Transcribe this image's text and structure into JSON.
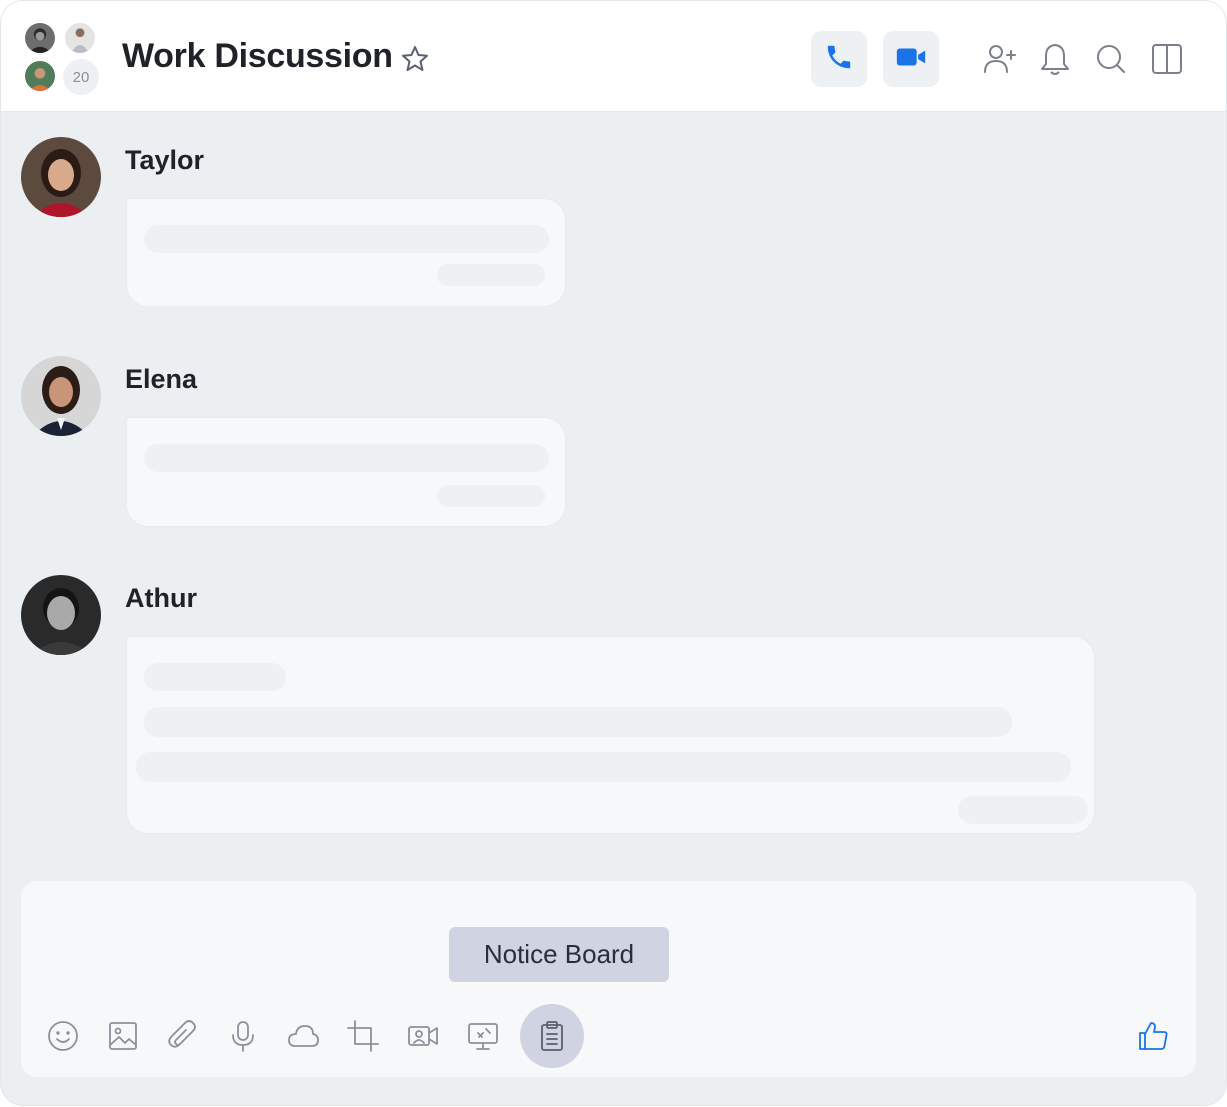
{
  "header": {
    "title": "Work Discussion",
    "member_count": "20",
    "icons": [
      "star-icon",
      "phone-icon",
      "video-icon",
      "add-user-icon",
      "bell-icon",
      "search-icon",
      "panel-icon"
    ]
  },
  "messages": [
    {
      "author": "Taylor"
    },
    {
      "author": "Elena"
    },
    {
      "author": "Athur"
    }
  ],
  "composer": {
    "tooltip": "Notice Board",
    "tools": [
      "emoji-icon",
      "image-icon",
      "attachment-icon",
      "microphone-icon",
      "cloud-icon",
      "crop-icon",
      "video-message-icon",
      "screen-share-icon",
      "notice-board-icon",
      "thumbs-up-icon"
    ]
  },
  "colors": {
    "accent": "#1a73e8",
    "background": "#eceff2",
    "bubble": "#f7f8f9",
    "tooltip": "#d0d3e1"
  }
}
